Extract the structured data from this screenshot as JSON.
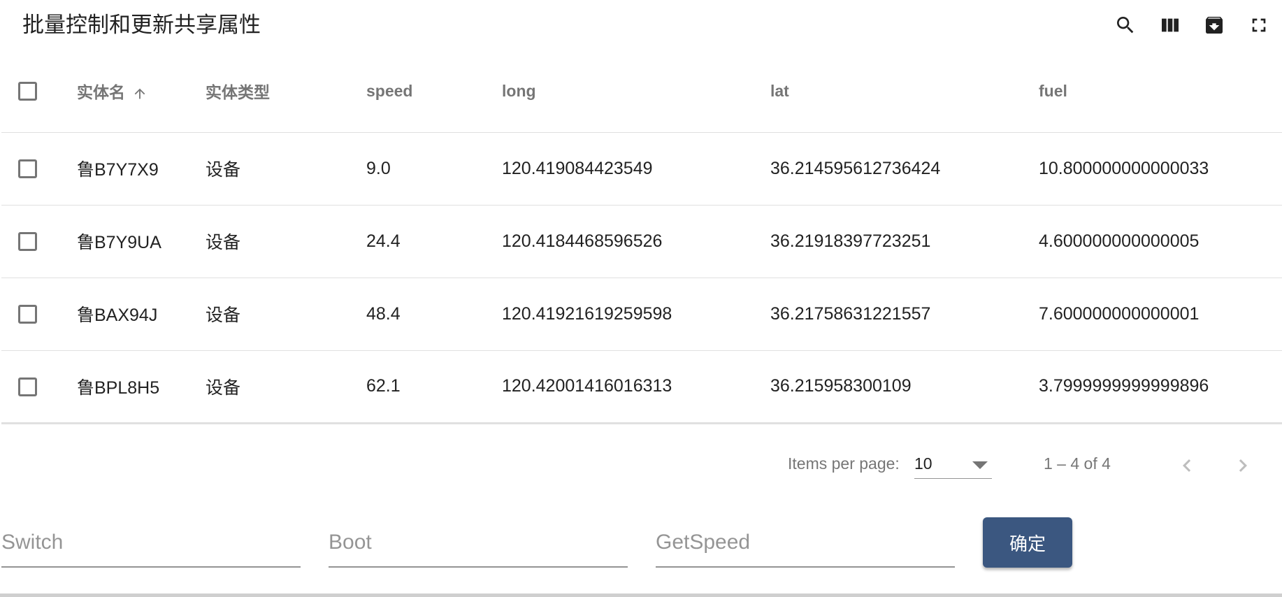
{
  "toolbar": {
    "title": "批量控制和更新共享属性",
    "icons": [
      "search-icon",
      "view-columns-icon",
      "archive-download-icon",
      "fullscreen-icon"
    ]
  },
  "table": {
    "columns": {
      "entity_name": "实体名",
      "entity_type": "实体类型",
      "speed": "speed",
      "long": "long",
      "lat": "lat",
      "fuel": "fuel"
    },
    "sort": {
      "column": "entity_name",
      "direction": "ascending",
      "icon": "arrow-up-icon"
    },
    "rows": [
      {
        "name": "鲁B7Y7X9",
        "type": "设备",
        "speed": "9.0",
        "long": "120.419084423549",
        "lat": "36.214595612736424",
        "fuel": "10.800000000000033"
      },
      {
        "name": "鲁B7Y9UA",
        "type": "设备",
        "speed": "24.4",
        "long": "120.4184468596526",
        "lat": "36.21918397723251",
        "fuel": "4.600000000000005"
      },
      {
        "name": "鲁BAX94J",
        "type": "设备",
        "speed": "48.4",
        "long": "120.41921619259598",
        "lat": "36.21758631221557",
        "fuel": "7.600000000000001"
      },
      {
        "name": "鲁BPL8H5",
        "type": "设备",
        "speed": "62.1",
        "long": "120.42001416016313",
        "lat": "36.215958300109",
        "fuel": "3.7999999999999896"
      }
    ]
  },
  "paginator": {
    "items_per_page_label": "Items per page:",
    "page_size": "10",
    "range_label": "1 – 4 of 4",
    "prev_icon": "chevron-left-icon",
    "next_icon": "chevron-right-icon"
  },
  "form": {
    "switch_placeholder": "Switch",
    "boot_placeholder": "Boot",
    "getspeed_placeholder": "GetSpeed",
    "submit_label": "确定"
  },
  "colors": {
    "primary_button": "#3b5780",
    "header_text": "rgba(0,0,0,0.54)",
    "divider": "#e0e0e0"
  }
}
